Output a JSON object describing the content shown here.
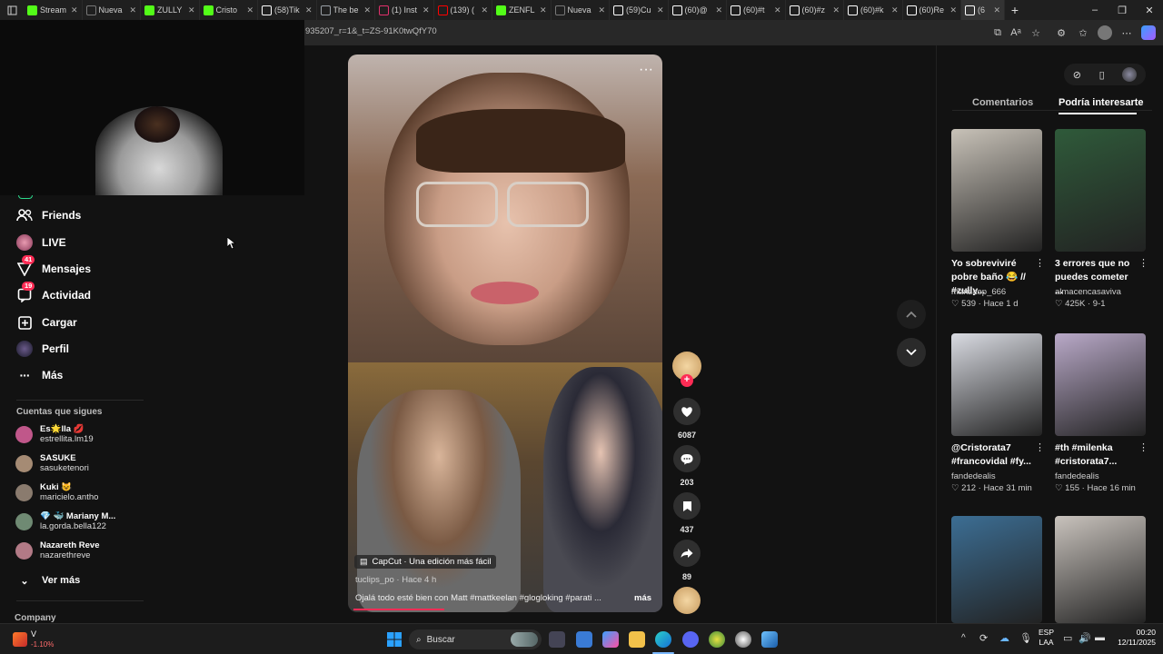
{
  "browser": {
    "tabs": [
      {
        "label": "Stream",
        "icon": "kick-icon",
        "color": "#53fc18"
      },
      {
        "label": "Nueva",
        "icon": "newtab-icon",
        "color": "#777777"
      },
      {
        "label": "ZULLY",
        "icon": "kick-icon",
        "color": "#53fc18"
      },
      {
        "label": "Cristo",
        "icon": "kick-icon",
        "color": "#53fc18"
      },
      {
        "label": "(58)Tik",
        "icon": "tiktok-icon",
        "color": "#ffffff"
      },
      {
        "label": "The be",
        "icon": "generic-icon",
        "color": "#9aa0a6"
      },
      {
        "label": "(1) Inst",
        "icon": "instagram-icon",
        "color": "#e1306c"
      },
      {
        "label": "(139) (",
        "icon": "youtube-icon",
        "color": "#ff0000"
      },
      {
        "label": "ZENFL",
        "icon": "kick-icon",
        "color": "#53fc18"
      },
      {
        "label": "Nueva",
        "icon": "newtab-icon",
        "color": "#777777"
      },
      {
        "label": "(59)Cu",
        "icon": "tiktok-icon",
        "color": "#ffffff"
      },
      {
        "label": "(60)@",
        "icon": "tiktok-icon",
        "color": "#ffffff"
      },
      {
        "label": "(60)#t",
        "icon": "tiktok-icon",
        "color": "#ffffff"
      },
      {
        "label": "(60)#z",
        "icon": "tiktok-icon",
        "color": "#ffffff"
      },
      {
        "label": "(60)#k",
        "icon": "tiktok-icon",
        "color": "#ffffff"
      },
      {
        "label": "(60)Re",
        "icon": "tiktok-icon",
        "color": "#ffffff"
      },
      {
        "label": "(6",
        "icon": "tiktok-icon",
        "color": "#ffffff"
      }
    ],
    "url": "935207_r=1&_t=ZS-91K0twQfY70"
  },
  "sidebar": {
    "nav": [
      {
        "label": "Friends",
        "icon": "friends-icon",
        "badge": ""
      },
      {
        "label": "LIVE",
        "icon": "live-icon",
        "badge": ""
      },
      {
        "label": "Mensajes",
        "icon": "messages-icon",
        "badge": "41"
      },
      {
        "label": "Actividad",
        "icon": "activity-icon",
        "badge": "19"
      },
      {
        "label": "Cargar",
        "icon": "upload-icon",
        "badge": ""
      },
      {
        "label": "Perfil",
        "icon": "profile-icon",
        "badge": ""
      },
      {
        "label": "Más",
        "icon": "more-icon",
        "badge": ""
      }
    ],
    "following_title": "Cuentas que sigues",
    "following": [
      {
        "name": "Es🌟lla 💋",
        "handle": "estrellita.lm19",
        "color": "#c0578a"
      },
      {
        "name": "SASUKE",
        "handle": "sasuketenori",
        "color": "#a58b74"
      },
      {
        "name": "Kuki 😺",
        "handle": "maricielo.antho",
        "color": "#8a7b6e"
      },
      {
        "name": "💎 🐳 Mariany M...",
        "handle": "la.gorda.bella122",
        "color": "#6f8a73"
      },
      {
        "name": "Nazareth Reve",
        "handle": "nazarethreve",
        "color": "#b27a86"
      }
    ],
    "see_more": "Ver más",
    "company": "Company"
  },
  "video": {
    "overlay_badge": "CapCut · Una edición más fácil",
    "author_line": "tuclips_po · Hace 4 h",
    "caption": "Ojalá todo esté bien con Matt #mattkeelan #glogloking #parati ...",
    "more": "más",
    "likes": "6087",
    "comments": "203",
    "saves": "437",
    "shares": "89"
  },
  "right_panel": {
    "tabs": [
      "Comentarios",
      "Podría interesarte"
    ],
    "active_tab": 1,
    "cards": [
      {
        "title": "Yo sobreviviré pobre baño 😂 // #zully...",
        "user": "marizaep_666",
        "likes": "539",
        "time": "Hace 1 d",
        "thumb": "#c8c2b8"
      },
      {
        "title": "3 errores que no puedes cometer ...",
        "user": "almacencasaviva",
        "likes": "425K",
        "time": "9-1",
        "thumb": "#2f5a3a"
      },
      {
        "title": "@Cristorata7 #francovidal #fy...",
        "user": "fandedealis",
        "likes": "212",
        "time": "Hace 31 min",
        "thumb": "#d9dbe2"
      },
      {
        "title": "#th #milenka #cristorata7...",
        "user": "fandedealis",
        "likes": "155",
        "time": "Hace 16 min",
        "thumb": "#b9a9c8"
      },
      {
        "title": "",
        "user": "",
        "likes": "",
        "time": "",
        "thumb": "#3c6e94"
      },
      {
        "title": "",
        "user": "",
        "likes": "",
        "time": "",
        "thumb": "#c9c3bd"
      }
    ]
  },
  "taskbar": {
    "stock_name": "V",
    "stock_change": "-1.10%",
    "search_label": "Buscar",
    "lang_top": "ESP",
    "lang_bottom": "LAA",
    "time": "00:20",
    "date": "12/11/2025"
  }
}
